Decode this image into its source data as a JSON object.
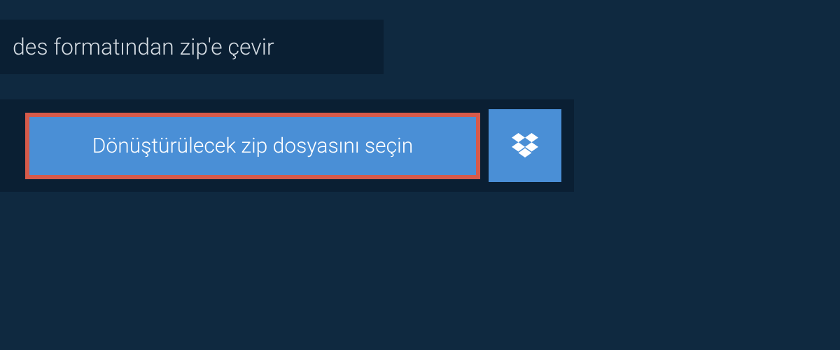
{
  "header": {
    "title": "des formatından zip'e çevir"
  },
  "upload": {
    "select_file_label": "Dönüştürülecek zip dosyasını seçin"
  },
  "colors": {
    "bg_dark": "#0f2940",
    "bg_darker": "#0a1f33",
    "button_blue": "#4a8fd6",
    "border_red": "#d65a4a"
  }
}
